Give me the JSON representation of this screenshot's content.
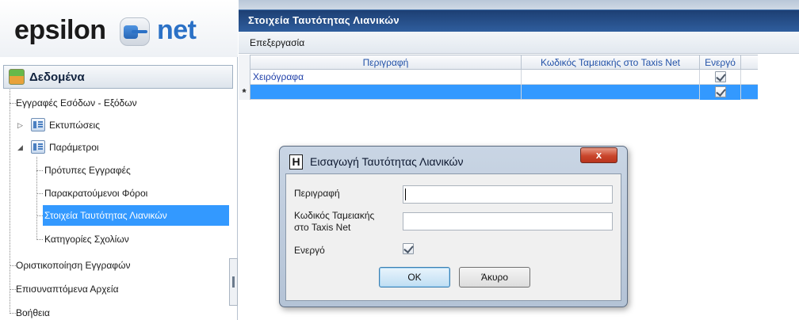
{
  "logo": {
    "part1": "epsilon",
    "part2": "net"
  },
  "tree": {
    "header": "Δεδομένα",
    "items": [
      {
        "label": "Εγγραφές Εσόδων - Εξόδων"
      },
      {
        "label": "Εκτυπώσεις"
      },
      {
        "label": "Παράμετροι"
      },
      {
        "label": "Πρότυπες Εγγραφές"
      },
      {
        "label": "Παρακρατούμενοι Φόροι"
      },
      {
        "label": "Στοιχεία Ταυτότητας Λιανικών"
      },
      {
        "label": "Κατηγορίες Σχολίων"
      },
      {
        "label": "Οριστικοποίηση Εγγραφών"
      },
      {
        "label": "Επισυναπτόμενα Αρχεία"
      },
      {
        "label": "Βοήθεια"
      }
    ]
  },
  "main": {
    "title": "Στοιχεία Ταυτότητας Λιανικών",
    "menu": "Επεξεργασία",
    "grid": {
      "columns": [
        "Περιγραφή",
        "Κωδικός Ταμειακής στο Taxis Net",
        "Ενεργό"
      ],
      "rows": [
        {
          "description": "Χειρόγραφα",
          "code": "",
          "active": true
        },
        {
          "description": "",
          "code": "",
          "active": true
        }
      ],
      "new_row_marker": "*"
    }
  },
  "dialog": {
    "title": "Εισαγωγή Ταυτότητας Λιανικών",
    "icon_letter": "H",
    "close_label": "x",
    "fields": {
      "description_label": "Περιγραφή",
      "description_value": "",
      "code_label_1": "Κωδικός Ταμειακής",
      "code_label_2": "στο Taxis Net",
      "code_value": "",
      "active_label": "Ενεργό",
      "active_value": true
    },
    "ok_label": "OK",
    "cancel_label": "Άκυρο"
  },
  "colors": {
    "title_bar": "#1d3f73",
    "selection": "#3399ff",
    "accent_blue": "#2b71c6",
    "close_red": "#c9452b"
  }
}
